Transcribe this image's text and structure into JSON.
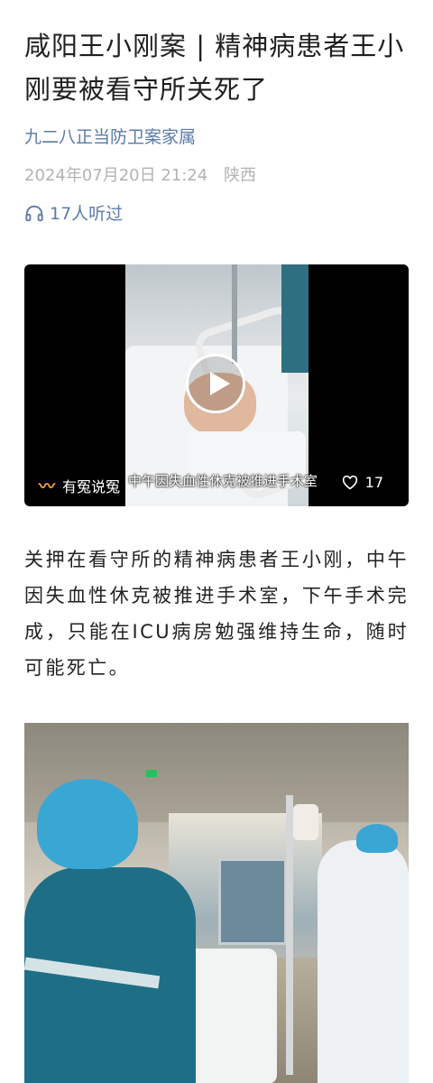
{
  "article": {
    "title": "咸阳王小刚案 | 精神病患者王小刚要被看守所关死了",
    "author": "九二八正当防卫案家属",
    "date": "2024年07月20日 21:24",
    "location": "陕西",
    "listen_count": "17人听过",
    "body": "关押在看守所的精神病患者王小刚，中午因失血性休克被推进手术室，下午手术完成，只能在ICU病房勉强维持生命，随时可能死亡。"
  },
  "video": {
    "caption": "中午因失血性休克被推进手术室",
    "source_name": "有冤说冤",
    "likes": "17"
  },
  "icons": {
    "headphones": "headphones-icon",
    "play": "play-icon",
    "heart": "heart-icon",
    "source_logo": "source-logo-icon"
  },
  "colors": {
    "link": "#5b7aa8",
    "meta": "#b3b3b3",
    "text": "#222222"
  }
}
